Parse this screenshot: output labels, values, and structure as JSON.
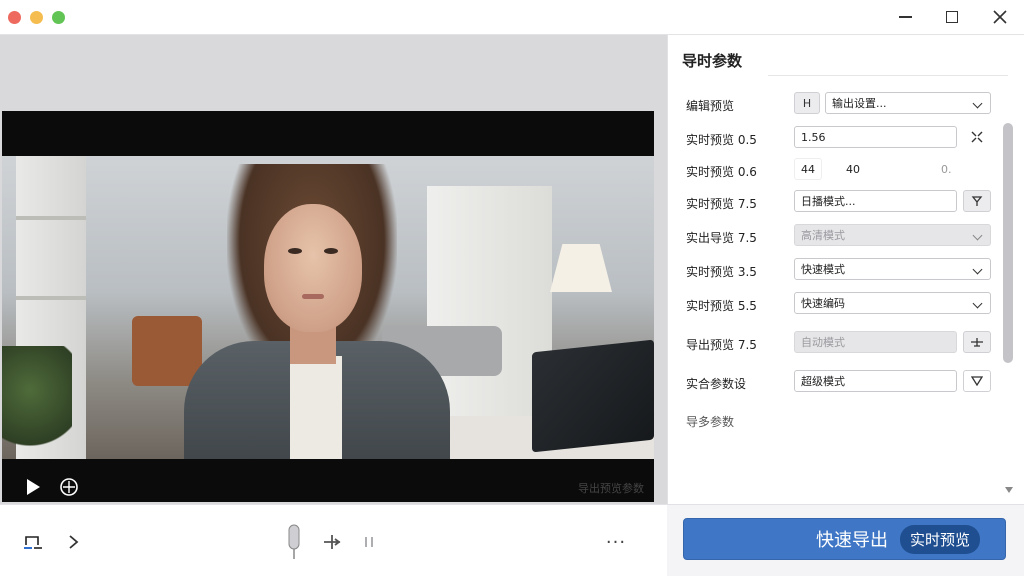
{
  "window": {
    "controls": {
      "minimize_icon": "minimize-icon",
      "maximize_icon": "maximize-icon",
      "close_icon": "close-icon"
    }
  },
  "player": {
    "play_icon": "play-icon",
    "loop_icon": "loop-icon",
    "info_text": "导出预览参数"
  },
  "toolbar": {
    "trim_icon": "trim-icon",
    "chevron_icon": "chevron-right-icon",
    "knob_icon": "slider-knob-icon",
    "move_icon": "move-icon",
    "pause_icon": "pause-icon",
    "more_label": "···"
  },
  "panel": {
    "title": "导时参数",
    "rows": [
      {
        "label": "编辑预览",
        "toggle": "H",
        "value": "输出设置..."
      },
      {
        "label": "实时预览 0.5",
        "value": "1.56",
        "icon": "compress-icon"
      },
      {
        "label": "实时预览 0.6",
        "value_a": "44",
        "value_b": "40",
        "value_c": "0."
      },
      {
        "label": "实时预览 7.5",
        "value": "日播模式...",
        "icon": "pin-icon"
      },
      {
        "label": "实出导览 7.5",
        "value": "高清模式"
      },
      {
        "label": "实时预览 3.5",
        "value": "快速模式"
      },
      {
        "label": "实时预览 5.5",
        "value": "快速编码"
      },
      {
        "label": "导出预览 7.5",
        "value": "自动模式",
        "icon": "adjust-icon"
      },
      {
        "label": "实合参数设",
        "value": "超级模式",
        "icon": "triangle-down-icon"
      }
    ],
    "footer_text": "导多参数"
  },
  "export": {
    "button_label": "快速导出",
    "pill_label": "实时预览"
  },
  "colors": {
    "accent": "#3f77c6",
    "accent_dark": "#1f4f91",
    "traffic_red": "#ee6a5f",
    "traffic_yellow": "#f5bd4f",
    "traffic_green": "#61c454"
  }
}
